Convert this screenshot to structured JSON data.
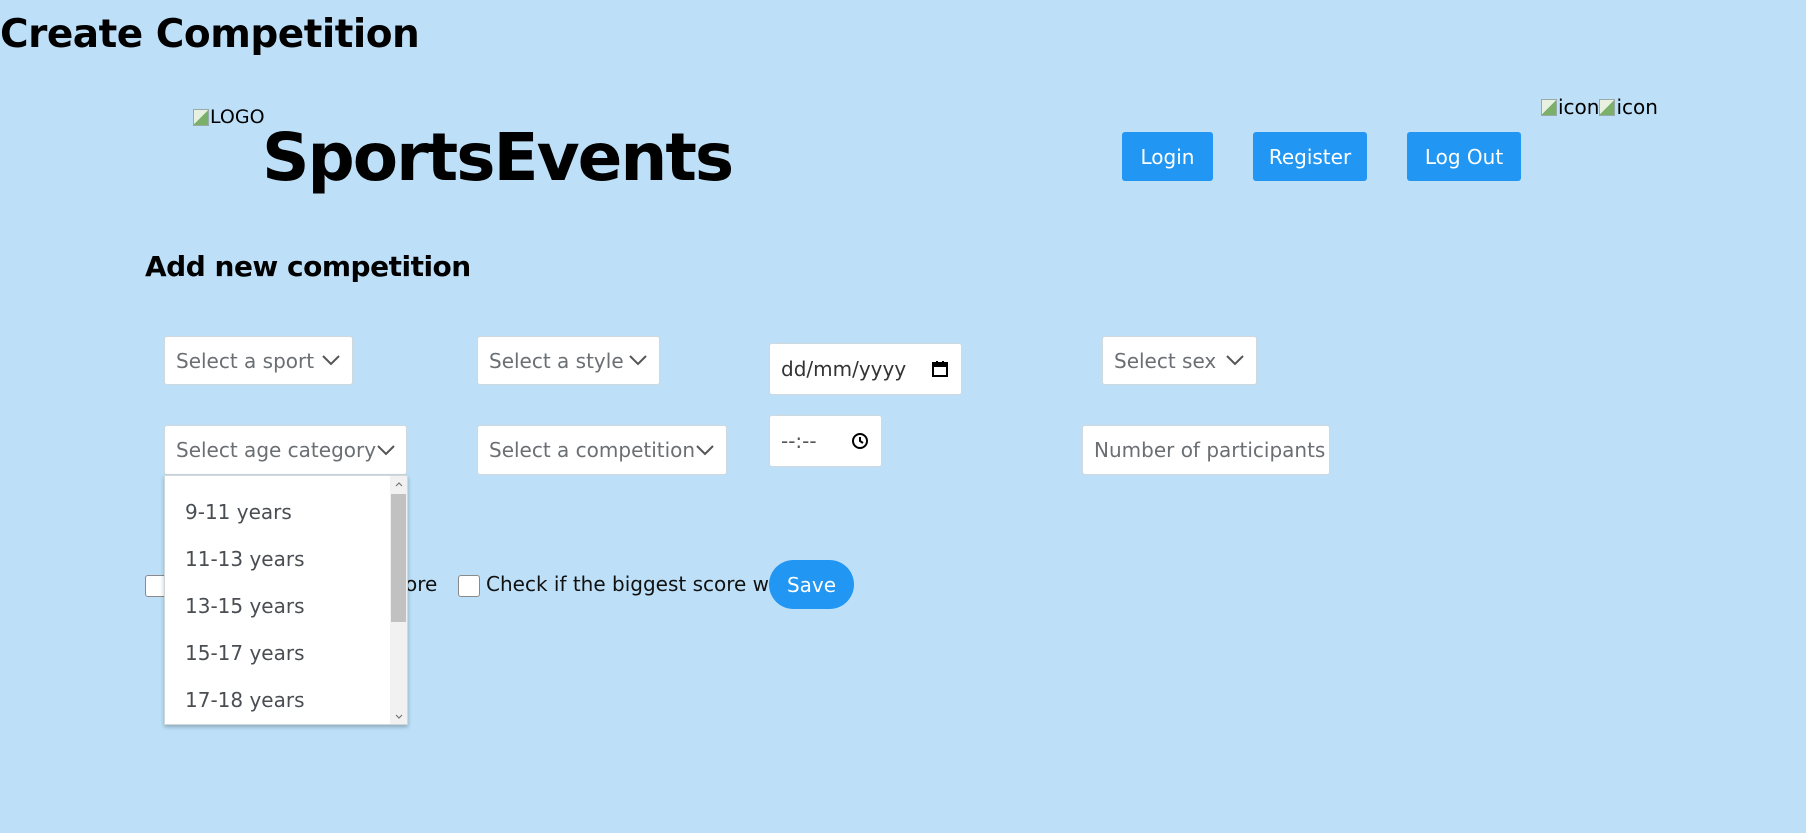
{
  "page_title": "Create Competition",
  "header": {
    "logo_alt": "LOGO",
    "brand": "SportsEvents",
    "login_label": "Login",
    "register_label": "Register",
    "logout_label": "Log Out",
    "icon1_alt": "icon",
    "icon2_alt": "icon"
  },
  "form": {
    "title": "Add new competition",
    "sport_placeholder": "Select a sport",
    "style_placeholder": "Select a style",
    "date_placeholder": "dd/mm/yyyy",
    "sex_placeholder": "Select sex",
    "age_placeholder": "Select age category",
    "competition_placeholder": "Select a competition",
    "time_placeholder": "--:--",
    "participants_placeholder": "Number of participants",
    "age_options": [
      "9-11 years",
      "11-13 years",
      "13-15 years",
      "15-17 years",
      "17-18 years"
    ],
    "check1_label_visible": "core",
    "check2_label": "Check if the biggest score wins",
    "save_label": "Save"
  },
  "colors": {
    "background": "#bde0f8",
    "accent": "#2196f3"
  }
}
